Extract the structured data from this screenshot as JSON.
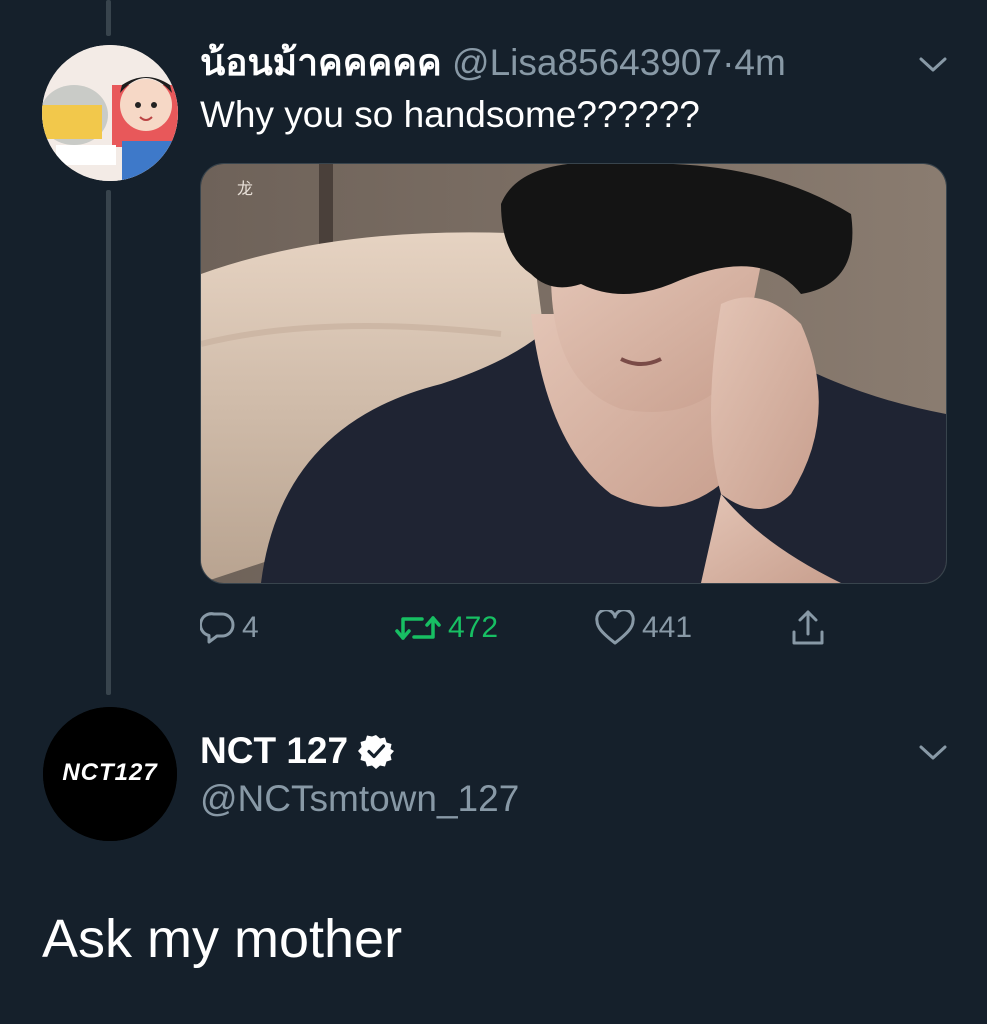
{
  "reply_tweet": {
    "display_name": "น้อนม้าคคคคค",
    "handle": "@Lisa85643907",
    "separator": "·",
    "time": "4m",
    "text": "Why you so handsome??????",
    "media_watermark": "龙",
    "actions": {
      "replies": "4",
      "retweets": "472",
      "likes": "441"
    },
    "colors": {
      "retweeted": "#17bf63"
    }
  },
  "main_tweet": {
    "display_name": "NCT 127",
    "verified": true,
    "handle": "@NCTsmtown_127",
    "avatar_logo_text": "NCT127",
    "text": "Ask my mother"
  },
  "theme": {
    "background": "#15202b",
    "secondary_text": "#8899a6",
    "line": "#38444d"
  }
}
